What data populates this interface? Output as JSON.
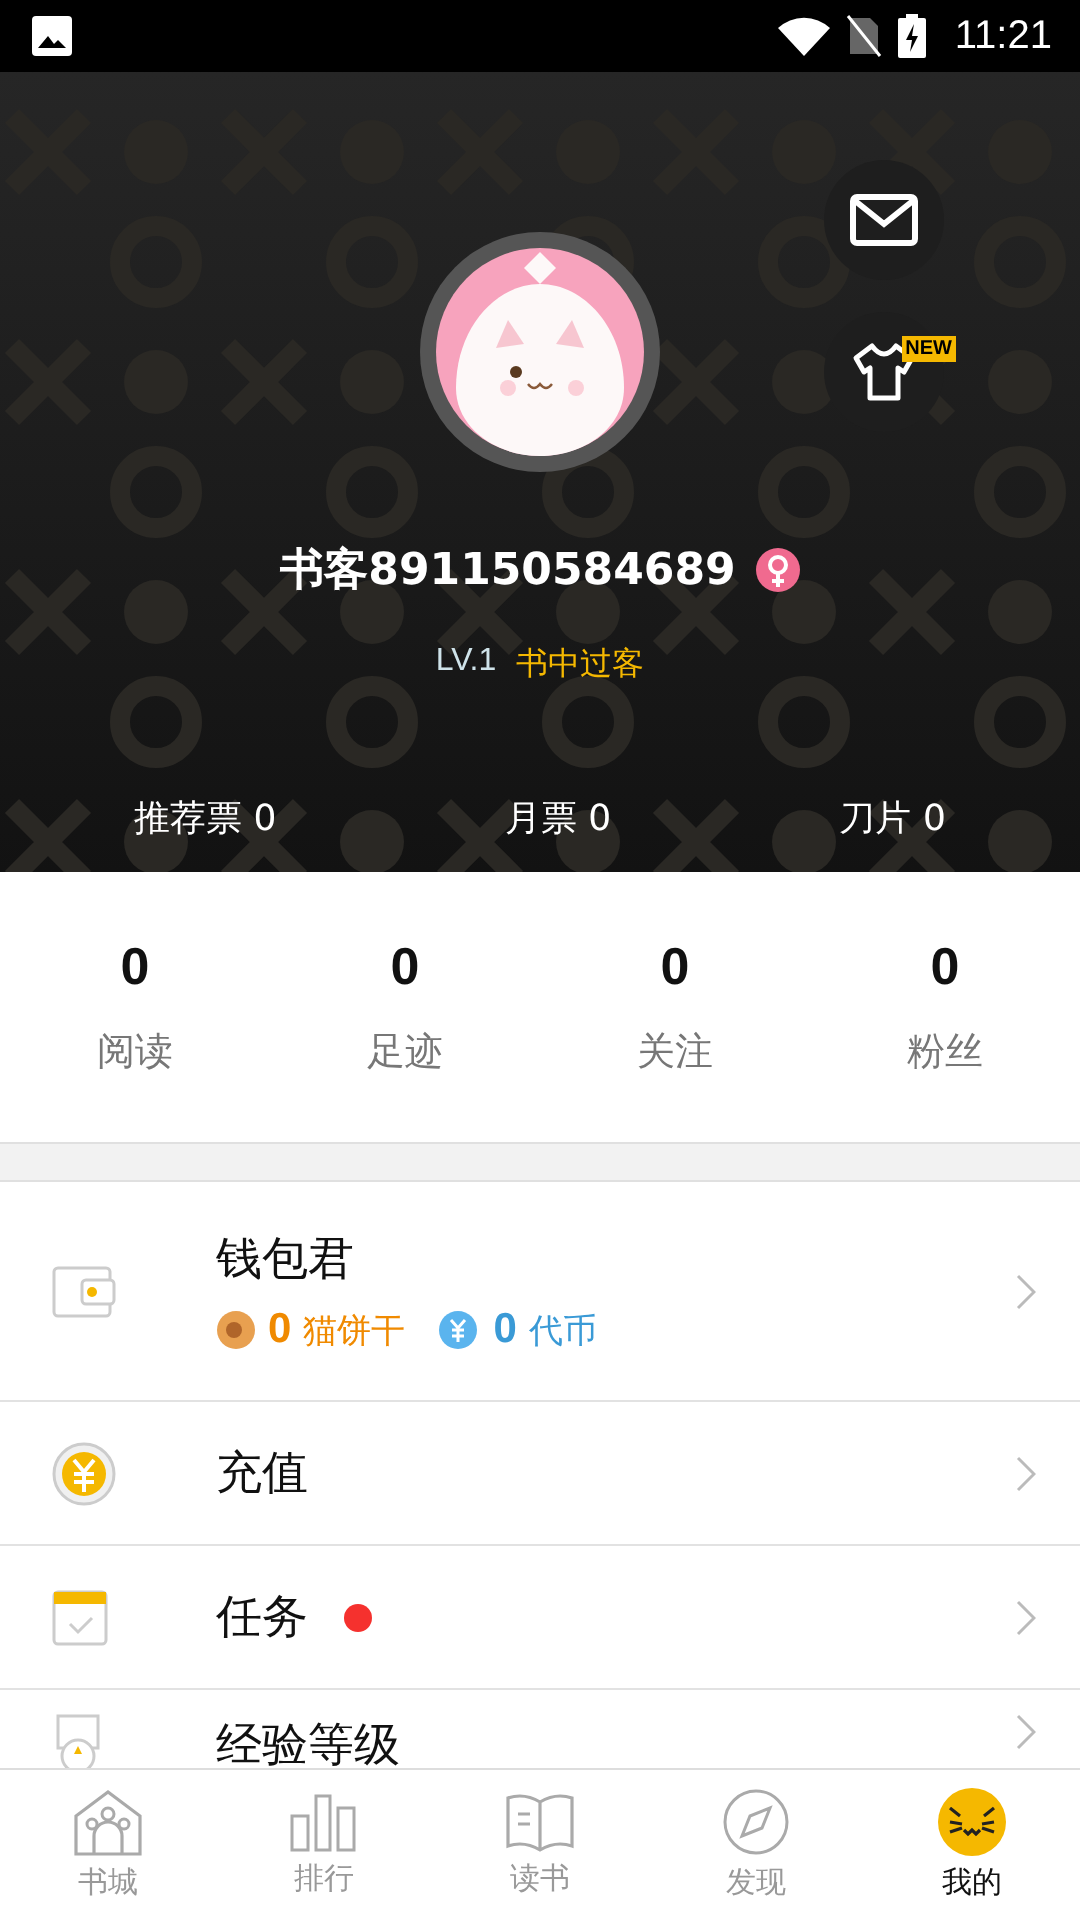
{
  "status_bar": {
    "time": "11:21"
  },
  "profile": {
    "name": "书客891150584689",
    "female": true,
    "level": "LV.1",
    "title": "书中过客",
    "new_badge": "NEW"
  },
  "tickets": [
    {
      "label": "推荐票 0"
    },
    {
      "label": "月票 0"
    },
    {
      "label": "刀片 0"
    }
  ],
  "stats": [
    {
      "value": "0",
      "label": "阅读"
    },
    {
      "value": "0",
      "label": "足迹"
    },
    {
      "value": "0",
      "label": "关注"
    },
    {
      "value": "0",
      "label": "粉丝"
    }
  ],
  "wallet": {
    "title": "钱包君",
    "biscuits": {
      "value": "0",
      "label": "猫饼干"
    },
    "coins": {
      "value": "0",
      "label": "代币"
    }
  },
  "menu": [
    {
      "kind": "recharge",
      "label": "充值",
      "dot": false
    },
    {
      "kind": "task",
      "label": "任务",
      "dot": true
    },
    {
      "kind": "level",
      "label": "经验等级",
      "dot": false
    }
  ],
  "tabs": [
    {
      "kind": "store",
      "label": "书城",
      "selected": false
    },
    {
      "kind": "rank",
      "label": "排行",
      "selected": false
    },
    {
      "kind": "read",
      "label": "读书",
      "selected": false
    },
    {
      "kind": "discover",
      "label": "发现",
      "selected": false
    },
    {
      "kind": "me",
      "label": "我的",
      "selected": true
    }
  ]
}
